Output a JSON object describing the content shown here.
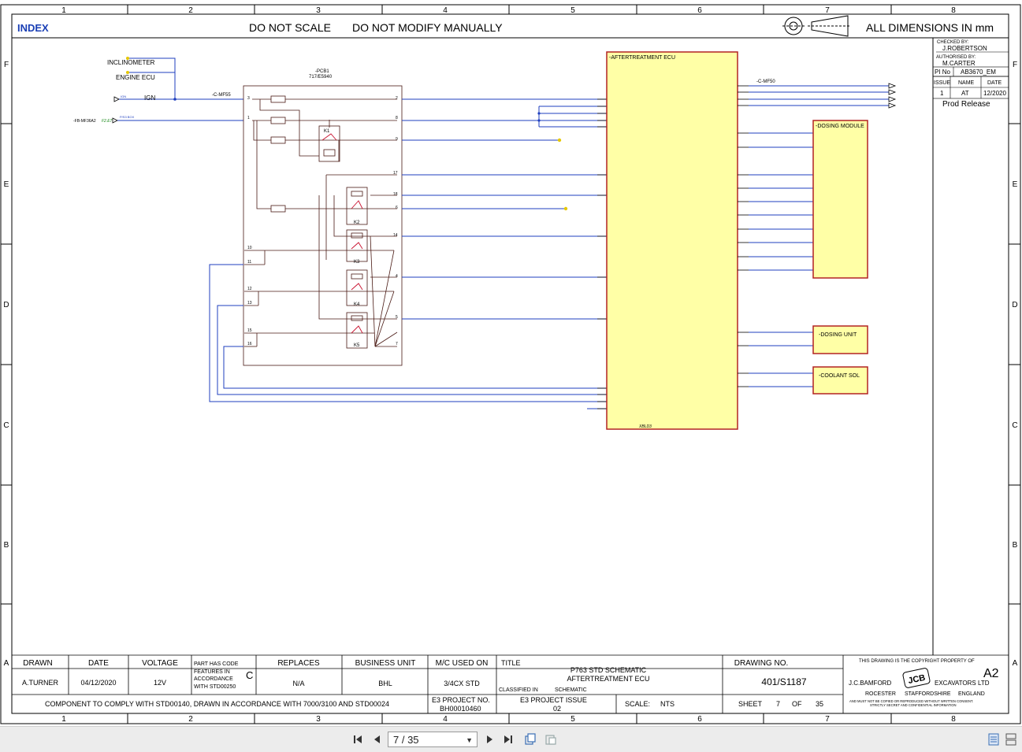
{
  "sheet": {
    "col_numbers": [
      "1",
      "2",
      "3",
      "4",
      "5",
      "6",
      "7",
      "8"
    ],
    "row_letters": [
      "F",
      "E",
      "D",
      "C",
      "B",
      "A"
    ]
  },
  "header": {
    "index_link": "INDEX",
    "no_scale": "DO NOT SCALE",
    "no_modify": "DO NOT MODIFY MANUALLY",
    "dimensions": "ALL DIMENSIONS IN mm"
  },
  "approval": {
    "checked_by_label": "CHECKED BY:",
    "checked_by": "J.ROBERTSON",
    "authorised_by_label": "AUTHORISED BY:",
    "authorised_by": "M.CARTER",
    "pi_no_label": "PI No",
    "pi_no": "AB3670_EM",
    "issue_label": "ISSUE",
    "name_label": "NAME",
    "date_label": "DATE",
    "issue": "1",
    "name": "AT",
    "date": "12/2020",
    "status": "Prod Release"
  },
  "schematic": {
    "inputs": {
      "inclinometer": "INCLINOMETER",
      "engine_ecu": "ENGINE ECU",
      "ign": "IGN",
      "ign_small": "IGN",
      "c_mf55": "-C-MF55",
      "fb_conn": "-FB-MF36A2",
      "fb_ref": "F2.E7",
      "fb_note": "P/S3 BOX"
    },
    "pcb": {
      "name": "-PCB1",
      "part_no": "717/E5940",
      "left_pins": [
        "3",
        "1",
        "10",
        "11",
        "12",
        "13",
        "15",
        "16"
      ],
      "right_pins": [
        "2",
        "8",
        "9",
        "17",
        "18",
        "6",
        "14",
        "4",
        "5",
        "7"
      ],
      "relays": [
        "K1",
        "K2",
        "K3",
        "K4",
        "K5"
      ]
    },
    "ecu": {
      "name": "-AFTERTREATMENT ECU",
      "footer": "XBLD3"
    },
    "c_mf50": "-C-MF50",
    "dosing_module": "-DOSING MODULE",
    "dosing_unit": "-DOSING UNIT",
    "coolant_sol": "-COOLANT SOL"
  },
  "title_block": {
    "drawn_label": "DRAWN",
    "drawn": "A.TURNER",
    "date_label": "DATE",
    "date": "04/12/2020",
    "voltage_label": "VOLTAGE",
    "voltage": "12V",
    "part_code_lines": [
      "PART HAS CODE",
      "FEATURES IN",
      "ACCORDANCE",
      "WITH STD00250"
    ],
    "part_code_letter": "C",
    "replaces_label": "REPLACES",
    "replaces": "N/A",
    "business_unit_label": "BUSINESS UNIT",
    "business_unit": "BHL",
    "mc_used_on_label": "M/C USED ON",
    "mc_used_on": "3/4CX STD",
    "title_label": "TITLE",
    "title_line1": "P763 STD SCHEMATIC",
    "title_line2": "AFTERTREATMENT ECU",
    "classified_label": "CLASSIFIED IN",
    "classified": "SCHEMATIC",
    "drawing_no_label": "DRAWING NO.",
    "drawing_no": "401/S1187",
    "copyright": "THIS DRAWING IS THE COPYRIGHT PROPERTY OF",
    "size": "A2",
    "company_left": "J.C.BAMFORD",
    "company_right": "EXCAVATORS LTD",
    "logo_text": "JCB",
    "addr_1": "ROCESTER",
    "addr_2": "STAFFORDSHIRE",
    "addr_3": "ENGLAND",
    "disclaimer_1": "AND MUST NOT BE COPIED OR REPRODUCED WITHOUT WRITTEN CONSENT.",
    "disclaimer_2": "STRICTLY SECRET AND CONFIDENTIAL INFORMATION",
    "compliance": "COMPONENT TO COMPLY WITH STD00140, DRAWN IN ACCORDANCE WITH 7000/3100 AND STD00024",
    "e3_project_no_label": "E3 PROJECT NO.",
    "e3_project_no": "BH00010460",
    "e3_issue_label": "E3 PROJECT ISSUE",
    "e3_issue": "02",
    "scale_label": "SCALE:",
    "scale": "NTS",
    "sheet_label": "SHEET",
    "sheet_no": "7",
    "of_label": "OF",
    "sheet_total": "35"
  },
  "viewer": {
    "page_display": "7 / 35",
    "first_icon": "first-page-icon",
    "prev_icon": "prev-page-icon",
    "next_icon": "next-page-icon",
    "last_icon": "last-page-icon"
  },
  "colors": {
    "frame": "#000000",
    "wire_blue": "#1f3fbf",
    "wire_dark": "#4a1a14",
    "box_fill": "#ffffa6",
    "box_stroke": "#b22222",
    "index_blue": "#1a3fb5"
  }
}
